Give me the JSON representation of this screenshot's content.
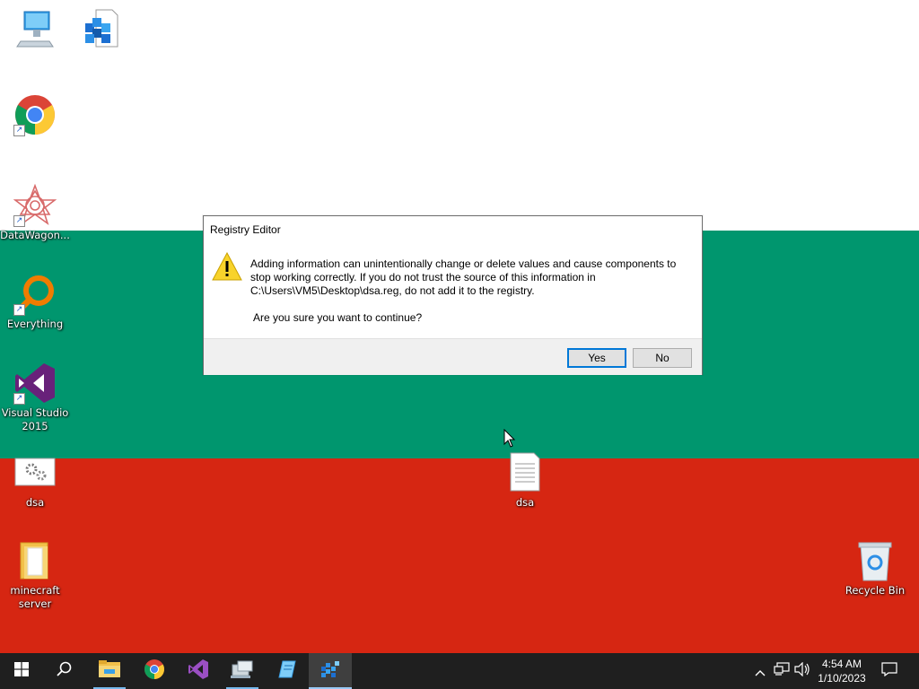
{
  "desktop": {
    "background_colors": {
      "top": "#ffffff",
      "middle": "#00966e",
      "bottom": "#d62612"
    },
    "icons": [
      {
        "name": "this-pc",
        "label": "",
        "icon": "computer-icon"
      },
      {
        "name": "regedit-file",
        "label": "",
        "icon": "registry-icon"
      },
      {
        "name": "google-chrome",
        "label": "",
        "icon": "chrome-icon",
        "shortcut": true
      },
      {
        "name": "datawagon",
        "label": "DataWagon...",
        "icon": "datawagon-icon",
        "shortcut": true
      },
      {
        "name": "everything",
        "label": "Everything",
        "icon": "everything-icon",
        "shortcut": true
      },
      {
        "name": "visual-studio",
        "label": "Visual Studio 2015",
        "icon": "visual-studio-icon",
        "shortcut": true
      },
      {
        "name": "dsa-reg",
        "label": "dsa",
        "icon": "settings-file-icon"
      },
      {
        "name": "dsa-txt",
        "label": "dsa",
        "icon": "text-file-icon"
      },
      {
        "name": "minecraft-server",
        "label": "minecraft server",
        "icon": "folder-icon"
      },
      {
        "name": "recycle-bin",
        "label": "Recycle Bin",
        "icon": "recycle-bin-icon"
      }
    ]
  },
  "dialog": {
    "title": "Registry Editor",
    "icon": "warning-icon",
    "message_line1": "Adding information can unintentionally change or delete values and cause components to",
    "message_line2": "stop working correctly. If you do not trust the source of this information in",
    "message_line3": "C:\\Users\\VM5\\Desktop\\dsa.reg, do not add it to the registry.",
    "question": "Are you sure you want to continue?",
    "yes_label": "Yes",
    "no_label": "No",
    "accent": "#0078d7"
  },
  "taskbar": {
    "buttons": [
      {
        "name": "start",
        "icon": "windows-logo-icon"
      },
      {
        "name": "search",
        "icon": "search-icon"
      },
      {
        "name": "file-explorer",
        "icon": "folder-icon"
      },
      {
        "name": "chrome",
        "icon": "chrome-icon"
      },
      {
        "name": "visual-studio",
        "icon": "visual-studio-icon"
      },
      {
        "name": "app-1",
        "icon": "network-app-icon"
      },
      {
        "name": "app-2",
        "icon": "notepad-icon"
      },
      {
        "name": "regedit",
        "icon": "registry-icon",
        "active": true
      }
    ],
    "tray": {
      "icons": [
        "chevron-up-icon",
        "network-icon",
        "volume-icon"
      ],
      "time": "4:54 AM",
      "date": "1/10/2023",
      "notification_icon": "notification-icon"
    }
  }
}
